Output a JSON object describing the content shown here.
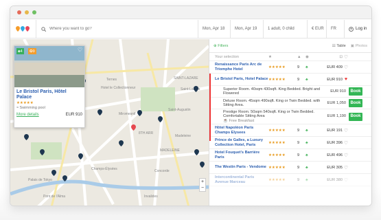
{
  "search": {
    "placeholder": "Where you want to go?"
  },
  "topbar": {
    "checkin": "Mon, Apr 18",
    "checkout": "Mon, Apr 19",
    "guests": "1 adult, 0 child",
    "currency": "€ EUR",
    "language": "FR",
    "login": "Log in"
  },
  "map": {
    "labels": [
      "Ternes",
      "Hotel le Collectionneur",
      "SAINT-LAZARE",
      "Saint-Lazare",
      "Miromesnil",
      "Saint-Augustin",
      "8TH ARR",
      "MADELEINE",
      "Madeleine",
      "Concorde",
      "Champs-Élysées",
      "Palais de Tokyo",
      "Pont de l'Alma",
      "Invalides"
    ],
    "selected_hotel": {
      "name": "Le Bristol Paris, Hôtel Palace",
      "badge_left": "4",
      "badge_right": "9",
      "amenity": "Swimming pool",
      "more": "More details",
      "price": "EUR 910",
      "rating": 5
    }
  },
  "panel": {
    "filters": "Filters",
    "view_table": "Table",
    "view_photos": "Photos",
    "header": {
      "selection": "Your selection"
    },
    "hotels": [
      {
        "name": "Renaissance Paris Arc de Triomphe Hotel",
        "score": "9",
        "price": "EUR 409"
      },
      {
        "name": "Le Bristol Paris, Hotel Palace",
        "score": "9",
        "price": "EUR 910"
      },
      {
        "name": "Hôtel Napoléon Paris Champs Elysees",
        "score": "9",
        "price": "EUR 191"
      },
      {
        "name": "Prince de Galles, a Luxury Collection Hotel, Paris",
        "score": "9",
        "price": "EUR 396"
      },
      {
        "name": "Hotel Fouquet's Barrière Paris",
        "score": "9",
        "price": "EUR 496"
      },
      {
        "name": "The Westin Paris - Vendome",
        "score": "9",
        "price": "EUR 305"
      },
      {
        "name": "Intercontinental Paris Avenue Marceau",
        "score": "9",
        "price": "EUR 380"
      }
    ],
    "rooms": [
      {
        "desc": "Superior Room. 40sqm 430sqft. King Bedded. Bright and Flowered",
        "price": "EUR 910",
        "book": "Book"
      },
      {
        "desc": "Deluxe Room. 45sqm 490sqft. King or Twin Bedded. with Sitting Area.",
        "price": "EUR 1,050",
        "book": "Book"
      },
      {
        "desc": "Prestige Room. 50sqm 540sqft. King or Twin Bedded. Comfortable Sitting Area",
        "price": "EUR 1,190",
        "book": "Book"
      }
    ],
    "breakfast": "Free Breakfast"
  }
}
